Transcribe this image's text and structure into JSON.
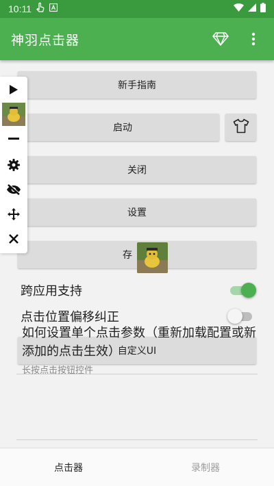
{
  "status_bar": {
    "time": "10:11",
    "icons": [
      "gesture-icon",
      "app-a-icon",
      "wifi-icon",
      "signal-icon",
      "battery-icon"
    ]
  },
  "app_bar": {
    "title": "神羽点击器",
    "actions": [
      "diamond-icon",
      "more-vert-icon"
    ]
  },
  "main": {
    "guide_label": "新手指南",
    "start_label": "启动",
    "close_label": "关闭",
    "settings_label": "设置",
    "save_label": "存",
    "cross_app": {
      "label": "跨应用支持",
      "on": true
    },
    "offset_fix": {
      "label": "点击位置偏移纠正",
      "on": false
    },
    "custom_ui_label": "自定义UI",
    "help": {
      "title": "如何设置单个点击参数（重新加载配置或新添加的点击生效）",
      "subtitle": "长按点击按钮控件"
    }
  },
  "floating_toolbar": {
    "items": [
      "play-icon",
      "avatar-thumbnail",
      "minus-icon",
      "gear-icon",
      "eye-off-icon",
      "move-icon",
      "close-icon"
    ]
  },
  "bottom_nav": {
    "tabs": [
      {
        "label": "点击器",
        "active": true
      },
      {
        "label": "录制器",
        "active": false
      }
    ]
  },
  "colors": {
    "primary": "#4caf50",
    "primary_dark": "#3a9a3e",
    "switch_on_track": "#a5d6a7",
    "button_bg": "#dcdcdc"
  }
}
